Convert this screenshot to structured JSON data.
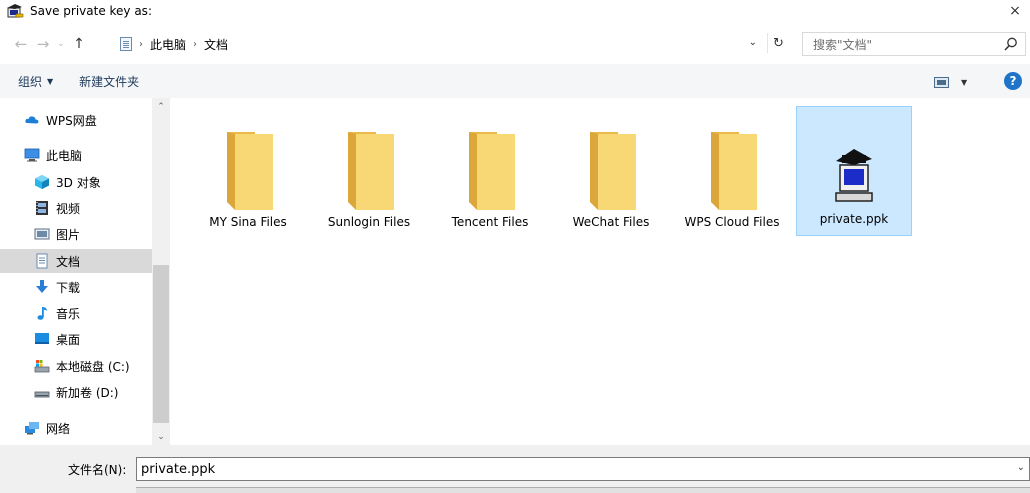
{
  "window": {
    "title": "Save private key as:",
    "close_label": "×"
  },
  "navigation": {
    "breadcrumb": [
      "此电脑",
      "文档"
    ],
    "search_placeholder": "搜索\"文档\""
  },
  "toolbar": {
    "organize_label": "组织",
    "new_folder_label": "新建文件夹",
    "help_label": "?"
  },
  "sidebar": {
    "items": [
      {
        "label": "WPS网盘",
        "icon": "cloud-icon"
      },
      {
        "label": "此电脑",
        "icon": "computer-icon"
      },
      {
        "label": "3D 对象",
        "icon": "cube-icon"
      },
      {
        "label": "视频",
        "icon": "video-icon"
      },
      {
        "label": "图片",
        "icon": "picture-icon"
      },
      {
        "label": "文档",
        "icon": "document-icon",
        "active": true
      },
      {
        "label": "下载",
        "icon": "download-icon"
      },
      {
        "label": "音乐",
        "icon": "music-icon"
      },
      {
        "label": "桌面",
        "icon": "desktop-icon"
      },
      {
        "label": "本地磁盘 (C:)",
        "icon": "drive-c-icon"
      },
      {
        "label": "新加卷 (D:)",
        "icon": "drive-d-icon"
      },
      {
        "label": "网络",
        "icon": "network-icon"
      }
    ]
  },
  "files": [
    {
      "name": "MY Sina Files",
      "type": "folder"
    },
    {
      "name": "Sunlogin Files",
      "type": "folder"
    },
    {
      "name": "Tencent Files",
      "type": "folder"
    },
    {
      "name": "WeChat Files",
      "type": "folder"
    },
    {
      "name": "WPS Cloud Files",
      "type": "folder"
    },
    {
      "name": "private.ppk",
      "type": "ppk",
      "selected": true
    }
  ],
  "filename": {
    "label": "文件名(N):",
    "value": "private.ppk"
  },
  "colors": {
    "accent": "#1f74c9",
    "selection": "#cce8ff",
    "folder": "#f8d775"
  }
}
